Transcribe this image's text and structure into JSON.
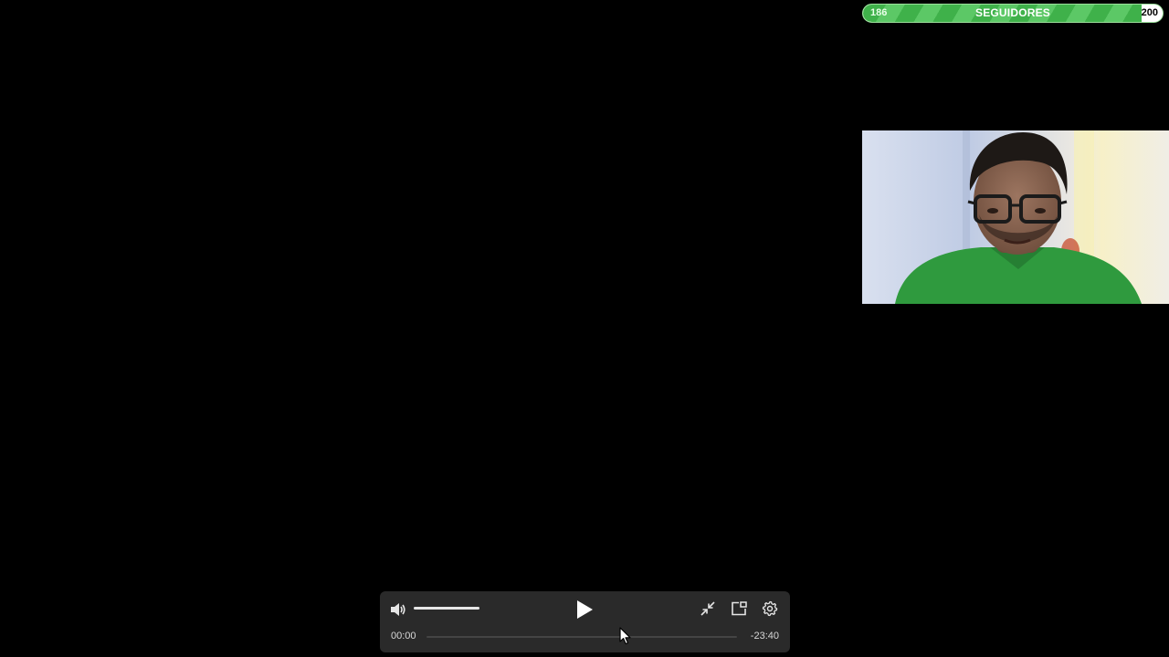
{
  "goal": {
    "current": "186",
    "label": "SEGUIDORES",
    "target": "200",
    "progress_fraction": 0.93,
    "fill_color": "#3fb14a"
  },
  "webcam": {
    "icon": "webcam-feed"
  },
  "player": {
    "volume_icon": "volume-icon",
    "volume_level": 1.0,
    "play_icon": "play-icon",
    "minimize_icon": "minimize-icon",
    "pip_icon": "picture-in-picture-icon",
    "settings_icon": "gear-icon",
    "time_current": "00:00",
    "time_remaining": "-23:40",
    "progress_fraction": 0.0
  }
}
